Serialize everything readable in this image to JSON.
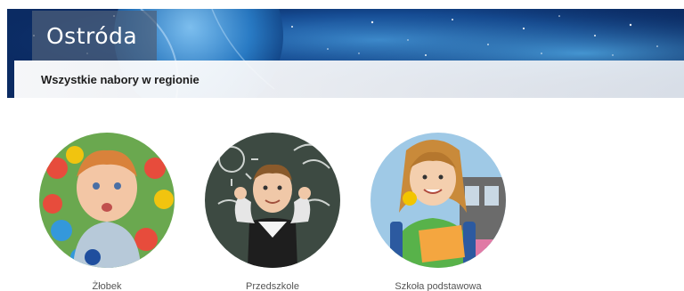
{
  "header": {
    "region_name": "Ostróda",
    "subtitle": "Wszystkie nabory w regionie"
  },
  "categories": [
    {
      "label": "Żłobek",
      "image": "toddler-photo"
    },
    {
      "label": "Przedszkole",
      "image": "preschool-boy-photo"
    },
    {
      "label": "Szkoła podstawowa",
      "image": "schoolgirl-photo"
    }
  ],
  "colors": {
    "hero_background": "#0b2b63",
    "region_box": "#4e607a",
    "label_text": "#555555"
  }
}
